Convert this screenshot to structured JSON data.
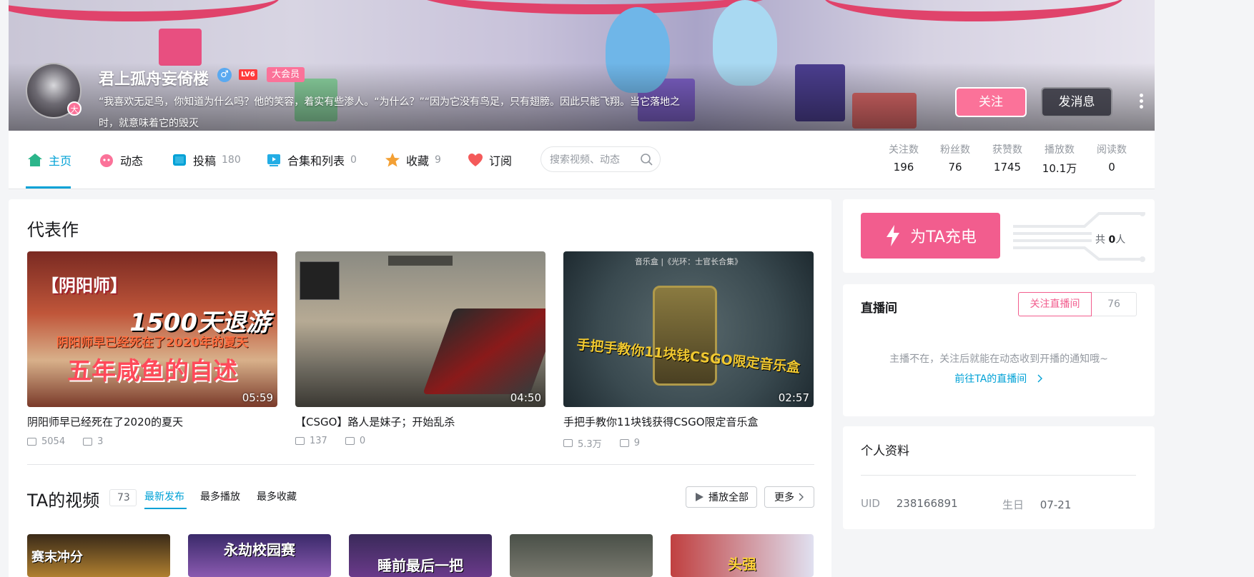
{
  "profile": {
    "username": "君上孤舟妄倚楼",
    "gender_symbol": "♂",
    "level": "LV6",
    "vip_label": "大会员",
    "avatar_badge": "大",
    "sign_line1": "“我喜欢无足鸟，你知道为什么吗？他的笑容，着实有些渗人。“为什么？”“因为它没有鸟足，只有翅膀。因此只能飞翔。当它落地之",
    "sign_line2": "时，就意味着它的毁灭",
    "follow_label": "关注",
    "message_label": "发消息"
  },
  "nav": {
    "items": [
      {
        "label": "主页",
        "count": ""
      },
      {
        "label": "动态",
        "count": ""
      },
      {
        "label": "投稿",
        "count": "180"
      },
      {
        "label": "合集和列表",
        "count": "0"
      },
      {
        "label": "收藏",
        "count": "9"
      },
      {
        "label": "订阅",
        "count": ""
      }
    ],
    "search_placeholder": "搜索视频、动态"
  },
  "stats": [
    {
      "label": "关注数",
      "value": "196"
    },
    {
      "label": "粉丝数",
      "value": "76"
    },
    {
      "label": "获赞数",
      "value": "1745"
    },
    {
      "label": "播放数",
      "value": "10.1万"
    },
    {
      "label": "阅读数",
      "value": "0"
    }
  ],
  "representative": {
    "title": "代表作",
    "videos": [
      {
        "title": "阴阳师早已经死在了2020的夏天",
        "duration": "05:59",
        "plays": "5054",
        "comments": "3",
        "cover_lines": [
          "【阴阳师】",
          "1500天退游",
          "阴阳师早已经死在了2020年的夏天",
          "五年咸鱼的自述"
        ]
      },
      {
        "title": "【CSGO】路人是妹子；开始乱杀",
        "duration": "04:50",
        "plays": "137",
        "comments": "0",
        "cover_lines": []
      },
      {
        "title": "手把手教你11块钱获得CSGO限定音乐盒",
        "duration": "02:57",
        "plays": "5.3万",
        "comments": "9",
        "cover_lines": [
          "音乐盒 |《光环：士官长合集》",
          "手把手教你11块钱CSGO限定音乐盒"
        ]
      }
    ]
  },
  "videos": {
    "title": "TA的视频",
    "count": "73",
    "sort_options": [
      "最新发布",
      "最多播放",
      "最多收藏"
    ],
    "play_all_label": "播放全部",
    "more_label": "更多",
    "thumb_captions": [
      "赛末冲分",
      "永劫校园赛",
      "睡前最后一把",
      "",
      "头强"
    ]
  },
  "charge": {
    "button_label": "为TA充电",
    "count_prefix": "共",
    "count_value": "0",
    "count_suffix": "人"
  },
  "live": {
    "title": "直播间",
    "follow_label": "关注直播间",
    "follow_count": "76",
    "tip": "主播不在，关注后就能在动态收到开播的通知哦~",
    "link_label": "前往TA的直播间"
  },
  "profile_card": {
    "title": "个人资料",
    "uid_label": "UID",
    "uid_value": "238166891",
    "birthday_label": "生日",
    "birthday_value": "07-21"
  },
  "colors": {
    "accent_blue": "#00a1d6",
    "accent_pink": "#fb7299",
    "charge_pink": "#f25d8e"
  }
}
